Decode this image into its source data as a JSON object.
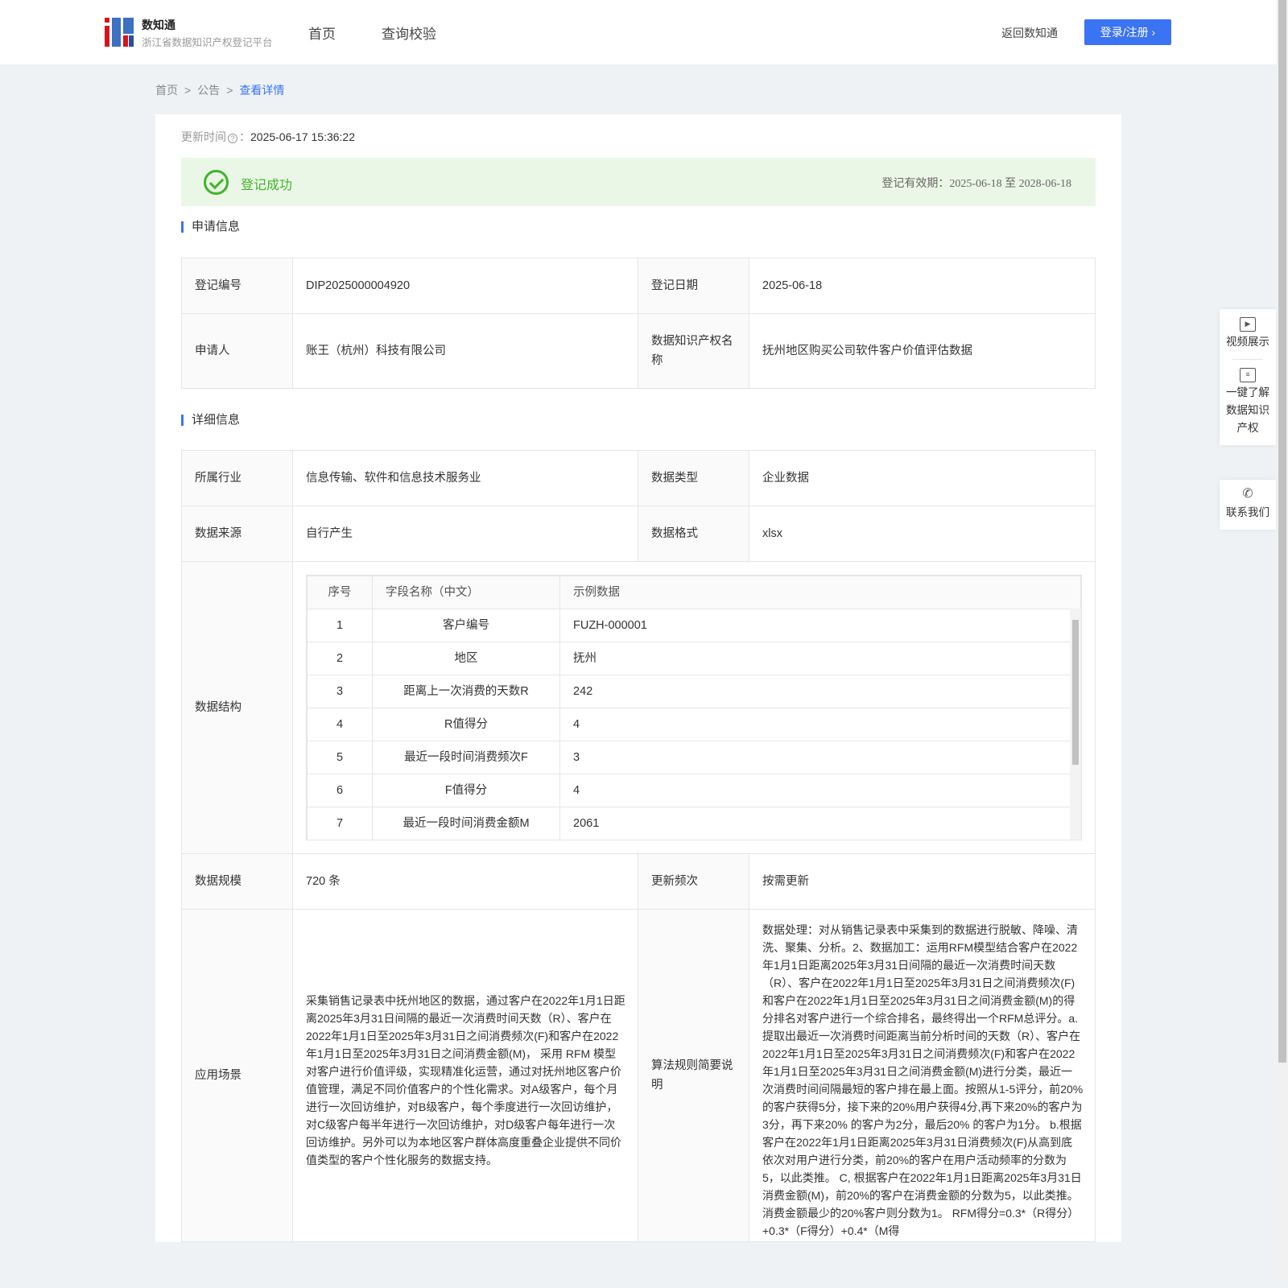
{
  "header": {
    "brand": "数知通",
    "subtitle": "浙江省数据知识产权登记平台",
    "nav": [
      "首页",
      "查询校验"
    ],
    "back": "返回数知通",
    "login": "登录/注册"
  },
  "breadcrumb": [
    "首页",
    "公告",
    "查看详情"
  ],
  "update": {
    "label": "更新时间",
    "value": "2025-06-17 15:36:22"
  },
  "status": {
    "text": "登记成功",
    "validity_label": "登记有效期：",
    "start": "2025-06-18",
    "to": "至",
    "end": "2028-06-18",
    "color": "#3fb52a"
  },
  "apply": {
    "title": "申请信息",
    "reg_no_label": "登记编号",
    "reg_no": "DIP2025000004920",
    "reg_date_label": "登记日期",
    "reg_date": "2025-06-18",
    "applicant_label": "申请人",
    "applicant": "账王（杭州）科技有限公司",
    "name_label": "数据知识产权名称",
    "name": "抚州地区购买公司软件客户价值评估数据"
  },
  "detail": {
    "title": "详细信息",
    "industry_label": "所属行业",
    "industry": "信息传输、软件和信息技术服务业",
    "type_label": "数据类型",
    "type": "企业数据",
    "source_label": "数据来源",
    "source": "自行产生",
    "format_label": "数据格式",
    "format": "xlsx",
    "structure_label": "数据结构",
    "structure": {
      "headers": [
        "序号",
        "字段名称（中文）",
        "示例数据"
      ],
      "rows": [
        [
          "1",
          "客户编号",
          "FUZH-000001"
        ],
        [
          "2",
          "地区",
          "抚州"
        ],
        [
          "3",
          "距离上一次消费的天数R",
          "242"
        ],
        [
          "4",
          "R值得分",
          "4"
        ],
        [
          "5",
          "最近一段时间消费频次F",
          "3"
        ],
        [
          "6",
          "F值得分",
          "4"
        ],
        [
          "7",
          "最近一段时间消费金额M",
          "2061"
        ]
      ]
    },
    "scale_label": "数据规模",
    "scale": "720 条",
    "freq_label": "更新频次",
    "freq": "按需更新",
    "scene_label": "应用场景",
    "scene": "采集销售记录表中抚州地区的数据，通过客户在2022年1月1日距离2025年3月31日间隔的最近一次消费时间天数（R）、客户在2022年1月1日至2025年3月31日之间消费频次(F)和客户在2022年1月1日至2025年3月31日之间消费金额(M)， 采用 RFM 模型对客户进行价值评级，实现精准化运营，通过对抚州地区客户价值管理，满足不同价值客户的个性化需求。对A级客户，每个月进行一次回访维护，对B级客户，每个季度进行一次回访维护，对C级客户每半年进行一次回访维护，对D级客户每年进行一次回访维护。另外可以为本地区客户群体高度重叠企业提供不同价值类型的客户个性化服务的数据支持。",
    "algo_label": "算法规则简要说明",
    "algo": "数据处理：对从销售记录表中采集到的数据进行脱敏、降噪、清洗、聚集、分析。2、数据加工：运用RFM模型结合客户在2022年1月1日距离2025年3月31日间隔的最近一次消费时间天数（R）、客户在2022年1月1日至2025年3月31日之间消费频次(F)和客户在2022年1月1日至2025年3月31日之间消费金额(M)的得分排名对客户进行一个综合排名，最终得出一个RFM总评分。a.提取出最近一次消费时间距离当前分析时间的天数（R）、客户在2022年1月1日至2025年3月31日之间消费频次(F)和客户在2022年1月1日至2025年3月31日之间消费金额(M)进行分类，最近一次消费时间间隔最短的客户排在最上面。按照从1-5评分，前20%的客户获得5分，接下来的20%用户获得4分,再下来20%的客户为3分，再下来20% 的客户为2分，最后20% 的客户为1分。 b.根据客户在2022年1月1日距离2025年3月31日消费频次(F)从高到底依次对用户进行分类，前20%的客户在用户活动频率的分数为5，以此类推。 C, 根据客户在2022年1月1日距离2025年3月31日消费金额(M)，前20%的客户在消费金额的分数为5，以此类推。消费金额最少的20%客户则分数为1。 RFM得分=0.3*（R得分）+0.3*（F得分）+0.4*（M得"
  },
  "float": {
    "video": "视频展示",
    "learn": "一键了解数据知识产权",
    "contact": "联系我们"
  }
}
